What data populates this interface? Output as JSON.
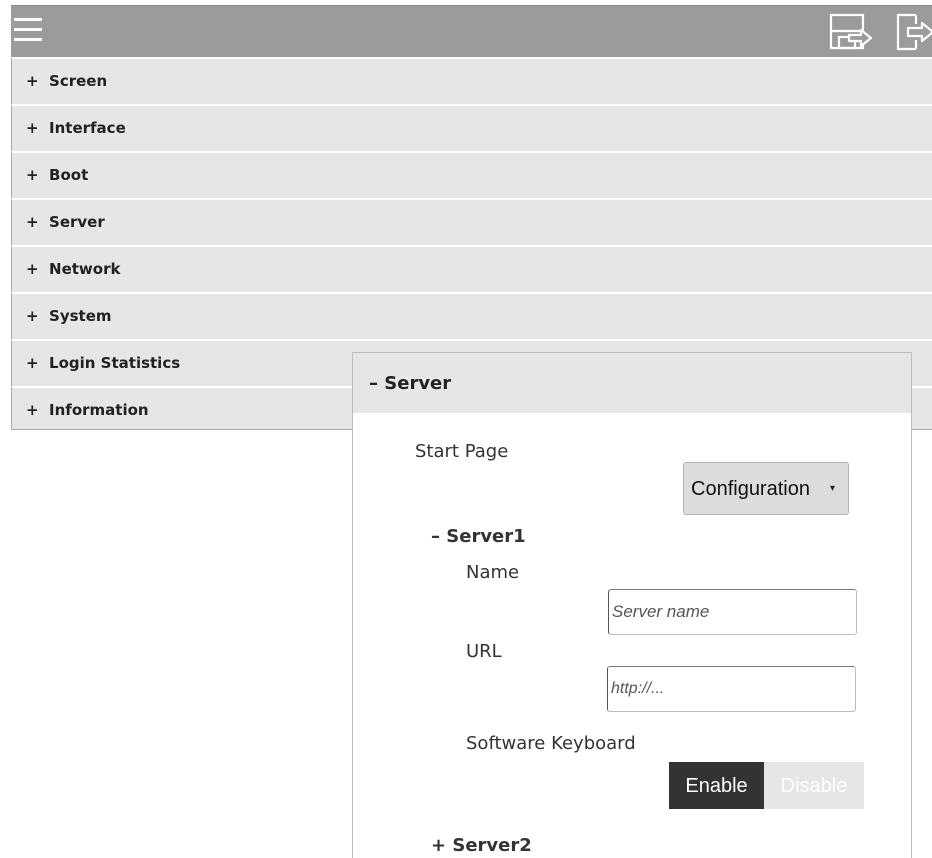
{
  "header": {
    "menu_icon": "hamburger-menu-icon",
    "save_icon": "save-exit-icon",
    "logout_icon": "logout-icon"
  },
  "menu": {
    "items": [
      {
        "prefix": "+",
        "label": "Screen"
      },
      {
        "prefix": "+",
        "label": "Interface"
      },
      {
        "prefix": "+",
        "label": "Boot"
      },
      {
        "prefix": "+",
        "label": "Server"
      },
      {
        "prefix": "+",
        "label": "Network"
      },
      {
        "prefix": "+",
        "label": "System"
      },
      {
        "prefix": "+",
        "label": "Login Statistics"
      },
      {
        "prefix": "+",
        "label": "Information"
      }
    ]
  },
  "panel": {
    "title": "–  Server",
    "start_page_label": "Start Page",
    "start_page_value": "Configuration",
    "caret": "▾",
    "server1": {
      "title": "–  Server1",
      "name_label": "Name",
      "name_placeholder": "Server name",
      "url_label": "URL",
      "url_placeholder": "http://...",
      "keyboard_label": "Software Keyboard",
      "enable_label": "Enable",
      "disable_label": "Disable"
    },
    "server2": {
      "title": "+  Server2"
    }
  },
  "colors": {
    "topbar": "#9b9b9b",
    "menu_bg": "#e6e6e6",
    "enable_bg": "#333333",
    "disable_bg": "#e6e6e6"
  }
}
